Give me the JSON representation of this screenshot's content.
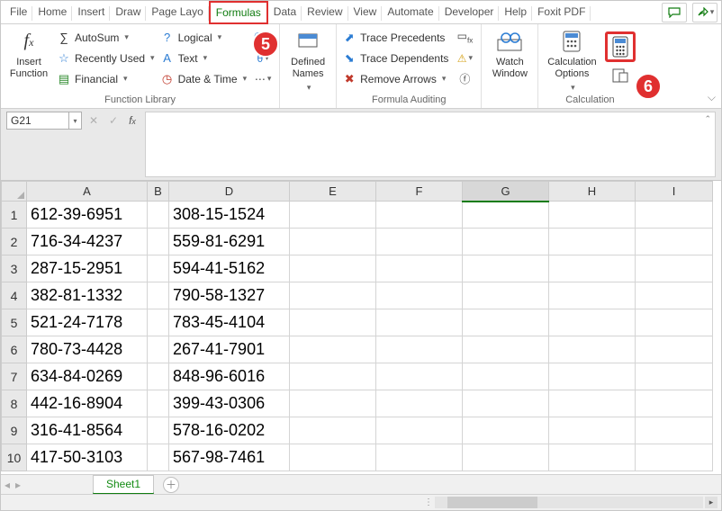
{
  "tabs": {
    "items": [
      "File",
      "Home",
      "Insert",
      "Draw",
      "Page Layo",
      "Formulas",
      "Data",
      "Review",
      "View",
      "Automate",
      "Developer",
      "Help",
      "Foxit PDF"
    ],
    "active_index": 5
  },
  "annotations": {
    "five": "5",
    "six": "6"
  },
  "ribbon": {
    "function_library": {
      "label": "Function Library",
      "insert_function": "Insert\nFunction",
      "autosum": "AutoSum",
      "recently_used": "Recently Used",
      "financial": "Financial",
      "logical": "Logical",
      "text": "Text",
      "date_time": "Date & Time"
    },
    "defined_names": {
      "label": "Defined\nNames"
    },
    "formula_auditing": {
      "label": "Formula Auditing",
      "trace_precedents": "Trace Precedents",
      "trace_dependents": "Trace Dependents",
      "remove_arrows": "Remove Arrows"
    },
    "watch_window": "Watch\nWindow",
    "calculation": {
      "label": "Calculation",
      "options": "Calculation\nOptions"
    }
  },
  "namebox": {
    "value": "G21"
  },
  "grid": {
    "columns": [
      "A",
      "B",
      "D",
      "E",
      "F",
      "G",
      "H",
      "I"
    ],
    "active_column": "G",
    "rows": [
      {
        "n": "1",
        "A": "612-39-6951",
        "D": "308-15-1524"
      },
      {
        "n": "2",
        "A": "716-34-4237",
        "D": "559-81-6291"
      },
      {
        "n": "3",
        "A": "287-15-2951",
        "D": "594-41-5162"
      },
      {
        "n": "4",
        "A": "382-81-1332",
        "D": "790-58-1327"
      },
      {
        "n": "5",
        "A": "521-24-7178",
        "D": "783-45-4104"
      },
      {
        "n": "6",
        "A": "780-73-4428",
        "D": "267-41-7901"
      },
      {
        "n": "7",
        "A": "634-84-0269",
        "D": "848-96-6016"
      },
      {
        "n": "8",
        "A": "442-16-8904",
        "D": "399-43-0306"
      },
      {
        "n": "9",
        "A": "316-41-8564",
        "D": "578-16-0202"
      },
      {
        "n": "10",
        "A": "417-50-3103",
        "D": "567-98-7461"
      }
    ]
  },
  "sheet_tabs": {
    "active": "Sheet1"
  }
}
